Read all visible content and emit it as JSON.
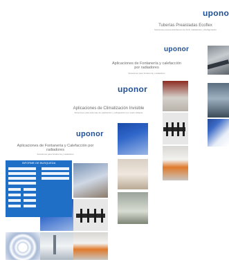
{
  "brochures": [
    {
      "logo": "uponor",
      "title": "Tuberías Preaisladas Ecoflex",
      "subtitle": "Soluciones para la distribución de ACS, Calefacción y Refrigeración"
    },
    {
      "logo": "uponor",
      "title": "Aplicaciones de Fontanería y calefacción por radiadores",
      "subtitle": "Soluciones para fontanería y radiadores"
    },
    {
      "logo": "uponor",
      "title": "Aplicaciones de Climatización Invisible",
      "subtitle": "Soluciones para sistemas de calefacción y refrigeración por suelo radiante"
    },
    {
      "logo": "uponor",
      "title": "Aplicaciones de Fontanería y Calefacción por radiadores",
      "subtitle": "Soluciones para fontanería y radiadores",
      "form_header": "INFORME DE BUSQUEDA"
    }
  ],
  "colors": {
    "brand_blue": "#1f4f95",
    "form_blue": "#1f6fc6",
    "text_gray": "#6a6a6a"
  }
}
